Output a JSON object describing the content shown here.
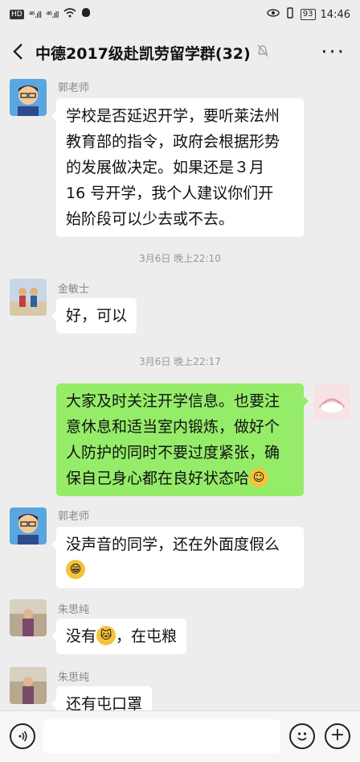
{
  "status_bar": {
    "left_badge": "HD",
    "signal1": "⁴⁶.ıll",
    "signal2": "⁴⁶.ıll",
    "battery": "93",
    "time": "14:46"
  },
  "header": {
    "title": "中德2017级赴凯劳留学群(32)",
    "back_icon": "chevron-left",
    "more_icon": "more-dots"
  },
  "messages": [
    {
      "sender": "郭老师",
      "side": "left",
      "lines": [
        "学校是否延迟开学，要听莱法州",
        "教育部的指令，政府会根据形势",
        "的发展做决定。如果还是３月",
        "16 号开学，我个人建议你们开",
        "始阶段可以少去或不去。"
      ]
    },
    {
      "timestamp": "3月6日 晚上22:10"
    },
    {
      "sender": "金敏士",
      "side": "left",
      "lines": [
        "好，可以"
      ]
    },
    {
      "timestamp": "3月6日 晚上22:17"
    },
    {
      "side": "right",
      "lines": [
        "大家及时关注开学信息。也要注",
        "意休息和适当室内锻炼，做好个",
        "人防护的同时不要过度紧张，确",
        "保自己身心都在良好状态哈"
      ],
      "trailing_emoji": "smile"
    },
    {
      "sender": "郭老师",
      "side": "left",
      "lines": [
        "没声音的同学，还在外面度假么"
      ],
      "trailing_emoji": "grin"
    },
    {
      "sender": "朱思纯",
      "side": "left",
      "lines_before": "没有",
      "inline_emoji": "cat",
      "lines_after": "，在屯粮"
    },
    {
      "sender": "朱思纯",
      "side": "left",
      "lines": [
        "还有屯口罩"
      ]
    }
  ],
  "colors": {
    "background": "#ededed",
    "bubble_left": "#ffffff",
    "bubble_right": "#95ec69",
    "timestamp": "#999999"
  }
}
